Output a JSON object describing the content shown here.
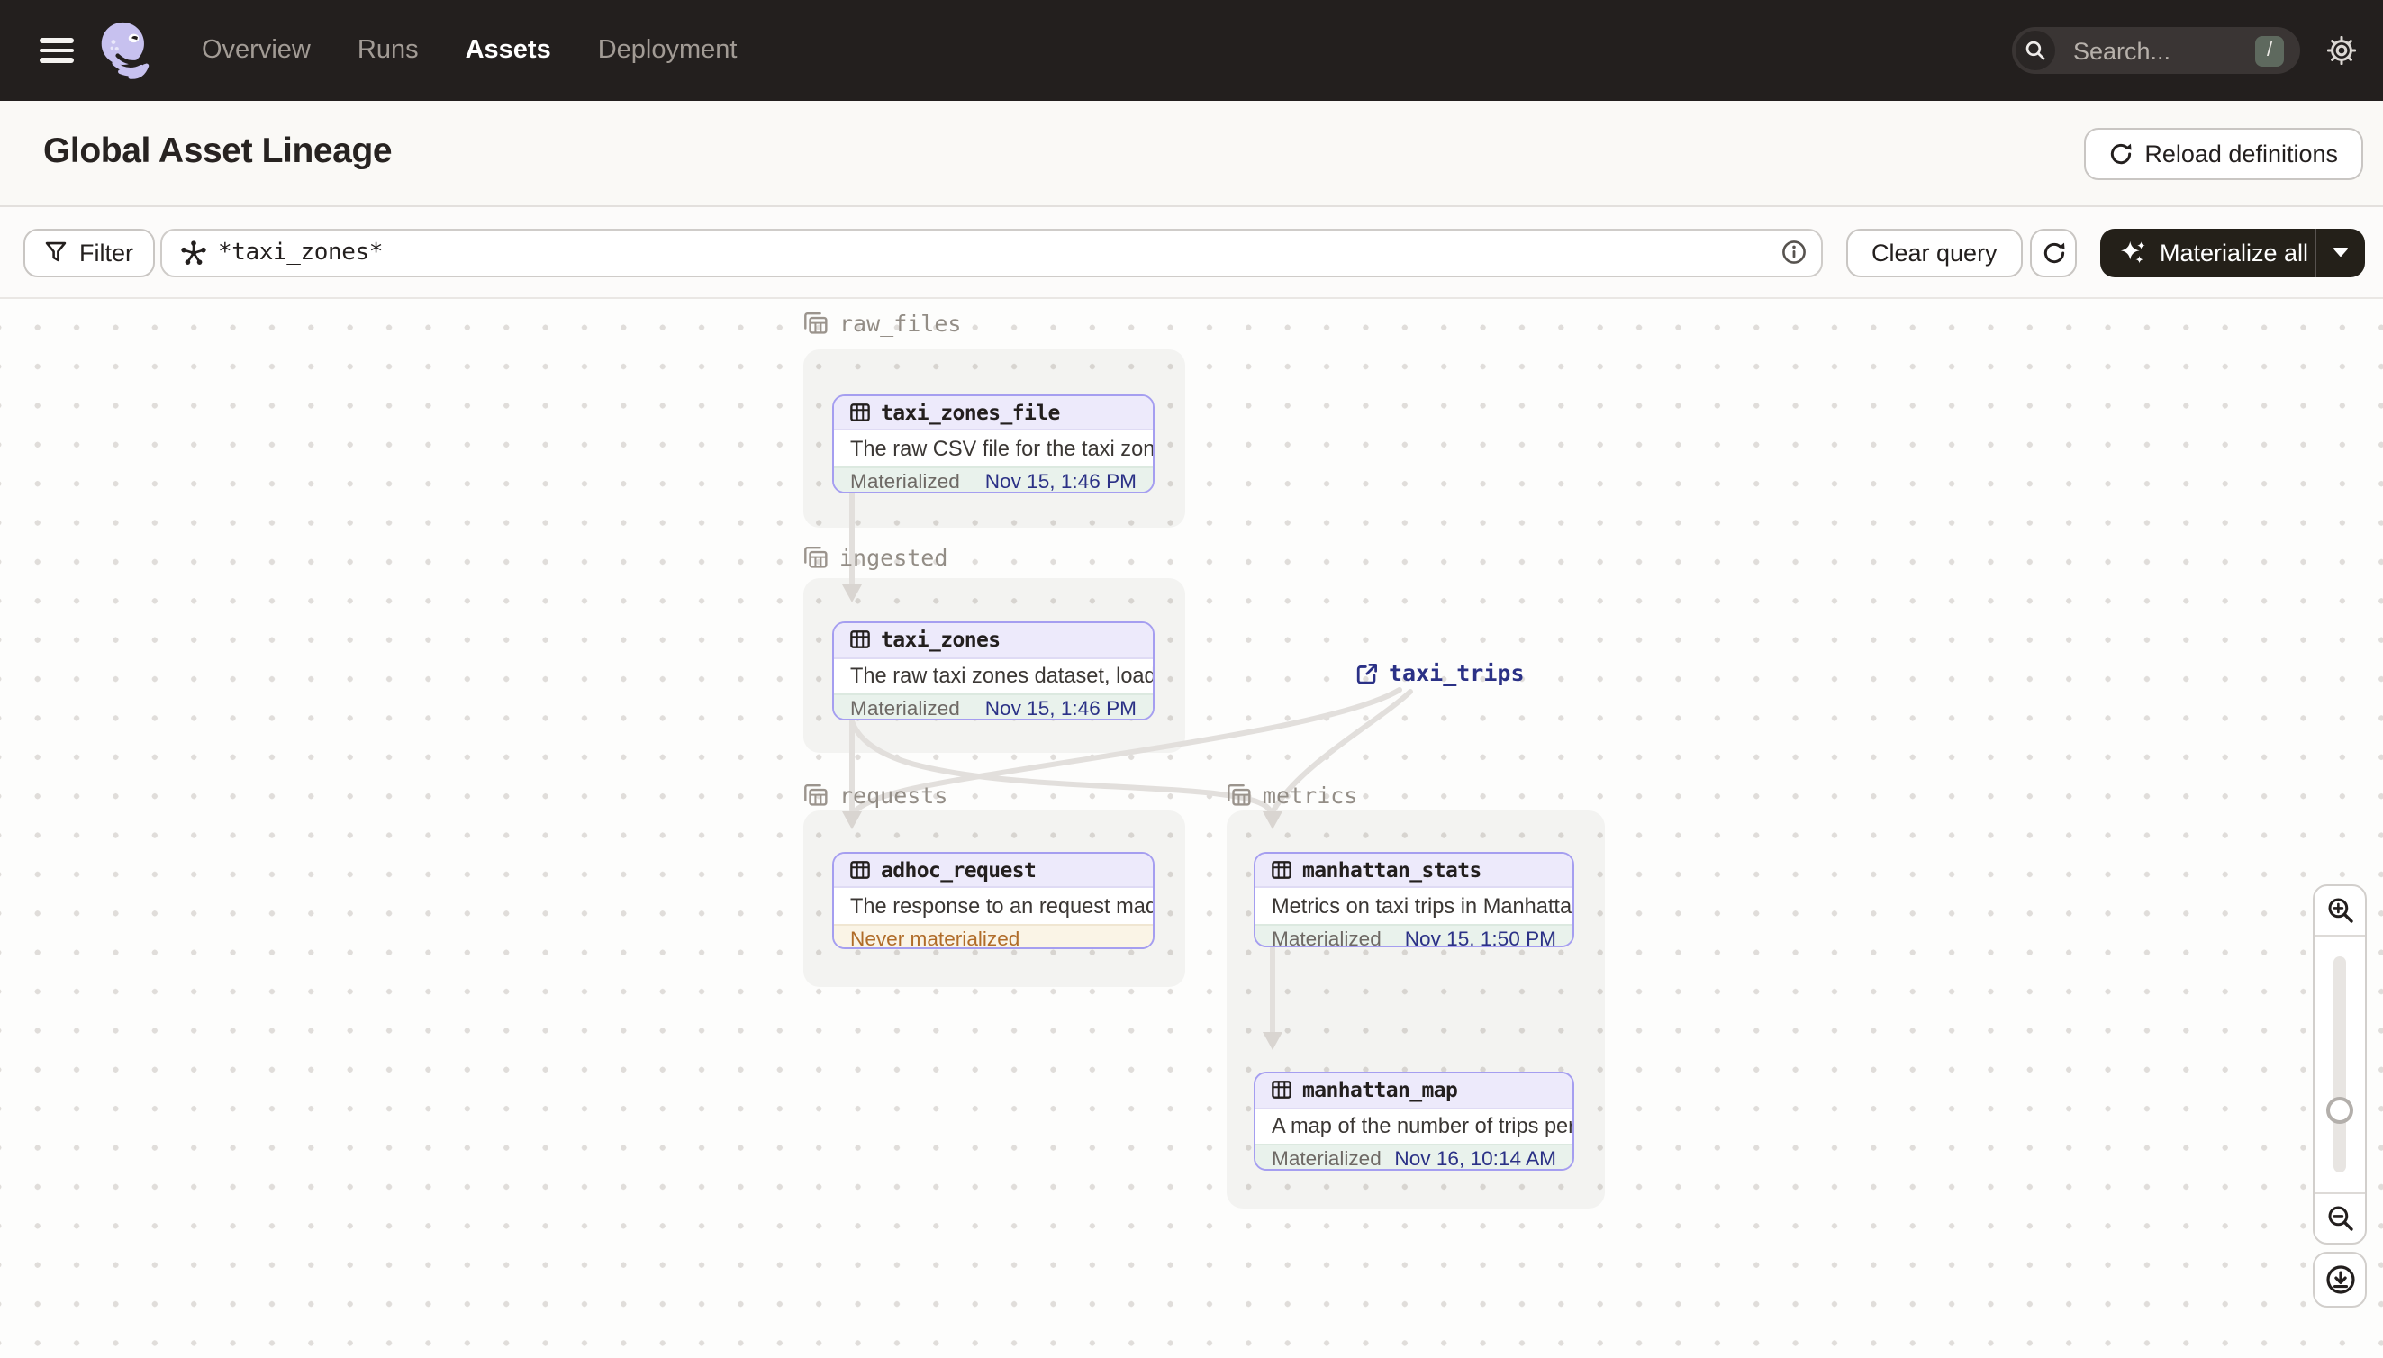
{
  "nav": {
    "items": [
      {
        "label": "Overview",
        "active": false
      },
      {
        "label": "Runs",
        "active": false
      },
      {
        "label": "Assets",
        "active": true
      },
      {
        "label": "Deployment",
        "active": false
      }
    ],
    "search": {
      "placeholder": "Search...",
      "shortcut": "/"
    }
  },
  "header": {
    "title": "Global Asset Lineage",
    "reload_button": "Reload definitions"
  },
  "toolbar": {
    "filter_button": "Filter",
    "query_input": {
      "value": "*taxi_zones*"
    },
    "clear_button": "Clear query",
    "materialize_button": "Materialize all"
  },
  "graph": {
    "groups": [
      {
        "name": "raw_files"
      },
      {
        "name": "ingested"
      },
      {
        "name": "requests"
      },
      {
        "name": "metrics"
      }
    ],
    "nodes": [
      {
        "name": "taxi_zones_file",
        "group": "raw_files",
        "description": "The raw CSV file for the taxi zones dat...",
        "status": "Materialized",
        "timestamp": "Nov 15, 1:46 PM"
      },
      {
        "name": "taxi_zones",
        "group": "ingested",
        "description": "The raw taxi zones dataset, loaded int...",
        "status": "Materialized",
        "timestamp": "Nov 15, 1:46 PM"
      },
      {
        "name": "adhoc_request",
        "group": "requests",
        "description": "The response to an request made in th...",
        "status": "Never materialized",
        "timestamp": ""
      },
      {
        "name": "manhattan_stats",
        "group": "metrics",
        "description": "Metrics on taxi trips in Manhattan",
        "status": "Materialized",
        "timestamp": "Nov 15, 1:50 PM"
      },
      {
        "name": "manhattan_map",
        "group": "metrics",
        "description": "A map of the number of trips per taxi z...",
        "status": "Materialized",
        "timestamp": "Nov 16, 10:14 AM"
      }
    ],
    "external_nodes": [
      {
        "name": "taxi_trips"
      }
    ],
    "edges": [
      {
        "from": "taxi_zones_file",
        "to": "taxi_zones"
      },
      {
        "from": "taxi_zones",
        "to": "adhoc_request"
      },
      {
        "from": "taxi_zones",
        "to": "manhattan_stats"
      },
      {
        "from": "taxi_trips",
        "to": "adhoc_request"
      },
      {
        "from": "taxi_trips",
        "to": "manhattan_stats"
      },
      {
        "from": "manhattan_stats",
        "to": "manhattan_map"
      }
    ]
  },
  "icons": {
    "hamburger-icon": "menu",
    "dagster-logo": "octopus",
    "search-icon": "magnifier",
    "gear-icon": "settings",
    "reload-icon": "circular-arrow",
    "filter-icon": "funnel",
    "asset-selector-icon": "graph-splat",
    "info-icon": "circled-i",
    "refresh-icon": "circular-arrow",
    "sparkle-icon": "four-point-stars",
    "caret-down-icon": "triangle-down",
    "group-icon": "layered-table",
    "table-icon": "grid-table",
    "external-link-icon": "arrow-out-of-box",
    "zoom-in-icon": "magnifier-plus",
    "zoom-out-icon": "magnifier-minus",
    "recenter-icon": "circled-down-arrow"
  },
  "colors": {
    "topbar_bg": "#231f1e",
    "accent_purple_border": "#a59ef0",
    "node_header_bg": "#edeafb",
    "materialized_bg": "#e9f2ec",
    "never_materialized_bg": "#faf4e6",
    "never_materialized_text": "#b06c29",
    "link_navy": "#2b3186",
    "group_label_gray": "#938d86",
    "edge_gray": "#e2dfdc",
    "shortcut_badge": "#5e695e"
  }
}
